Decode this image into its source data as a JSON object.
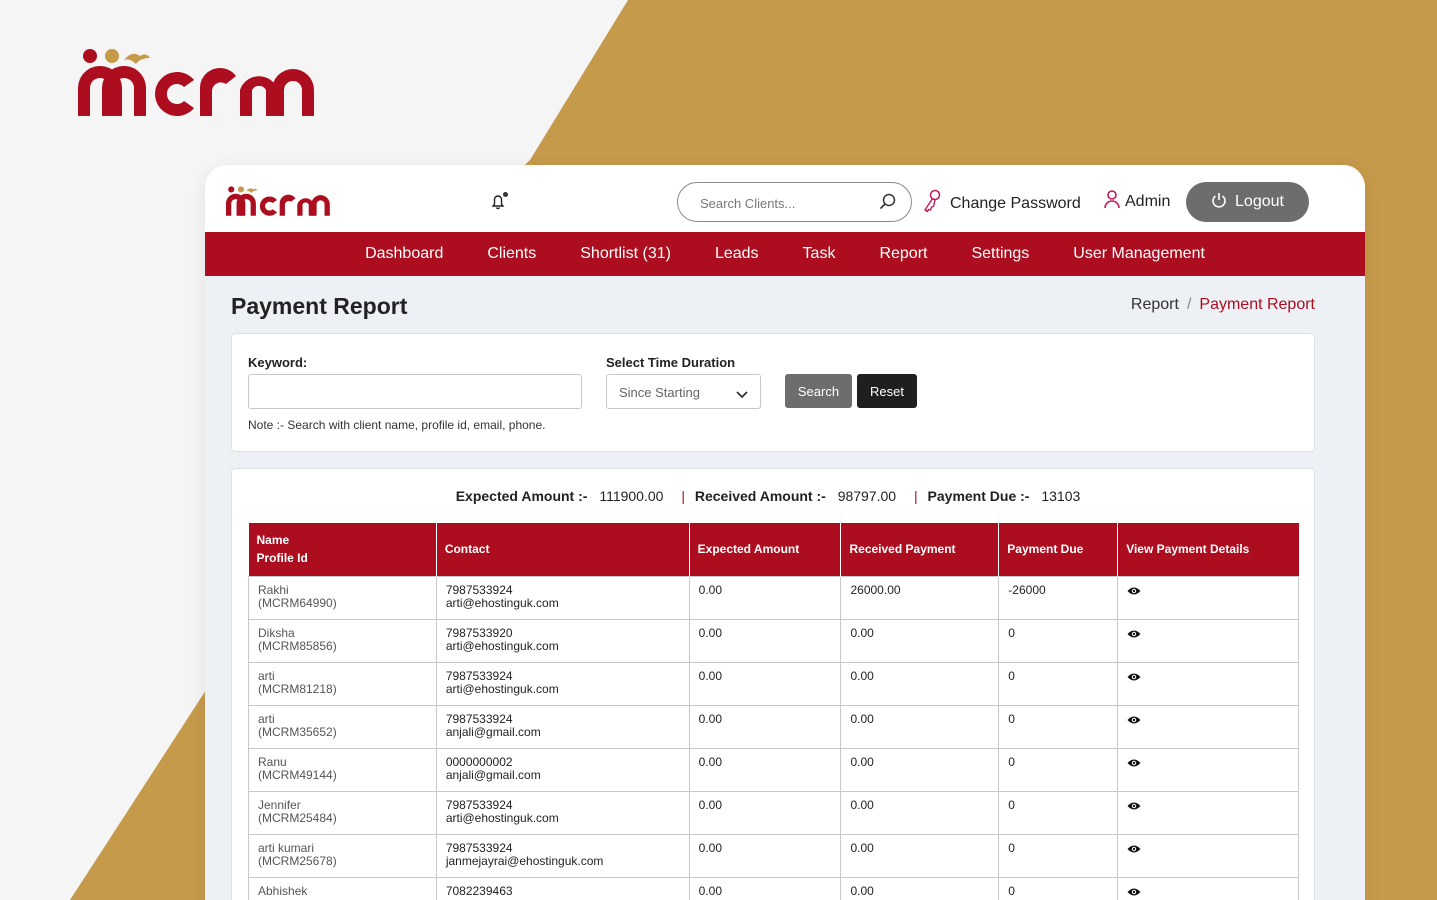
{
  "brand": {
    "name": "mcrm",
    "primary": "#ac0d1f",
    "gold": "#c69a4b"
  },
  "header": {
    "search_placeholder": "Search Clients...",
    "change_password": "Change Password",
    "admin": "Admin",
    "logout": "Logout"
  },
  "nav": [
    "Dashboard",
    "Clients",
    "Shortlist (31)",
    "Leads",
    "Task",
    "Report",
    "Settings",
    "User Management"
  ],
  "page": {
    "title": "Payment Report",
    "breadcrumb": {
      "parent": "Report",
      "separator": "/",
      "current": "Payment Report"
    }
  },
  "filters": {
    "keyword_label": "Keyword:",
    "keyword_value": "",
    "duration_label": "Select Time Duration",
    "duration_value": "Since Starting",
    "search_button": "Search",
    "reset_button": "Reset",
    "note": "Note :- Search with client name, profile id, email, phone."
  },
  "summary": {
    "expected_label": "Expected Amount :-",
    "expected_value": "111900.00",
    "received_label": "Received Amount :-",
    "received_value": "98797.00",
    "due_label": "Payment Due :-",
    "due_value": "13103"
  },
  "table": {
    "headers": {
      "name": "Name",
      "profile": "Profile Id",
      "contact": "Contact",
      "expected": "Expected Amount",
      "received": "Received Payment",
      "due": "Payment Due",
      "view": "View Payment Details"
    },
    "rows": [
      {
        "name": "Rakhi",
        "profile": "(MCRM64990)",
        "phone": "7987533924",
        "email": "arti@ehostinguk.com",
        "expected": "0.00",
        "received": "26000.00",
        "due": "-26000"
      },
      {
        "name": "Diksha",
        "profile": "(MCRM85856)",
        "phone": "7987533920",
        "email": "arti@ehostinguk.com",
        "expected": "0.00",
        "received": "0.00",
        "due": "0"
      },
      {
        "name": "arti",
        "profile": "(MCRM81218)",
        "phone": "7987533924",
        "email": "arti@ehostinguk.com",
        "expected": "0.00",
        "received": "0.00",
        "due": "0"
      },
      {
        "name": "arti",
        "profile": "(MCRM35652)",
        "phone": "7987533924",
        "email": "anjali@gmail.com",
        "expected": "0.00",
        "received": "0.00",
        "due": "0"
      },
      {
        "name": "Ranu",
        "profile": "(MCRM49144)",
        "phone": "0000000002",
        "email": "anjali@gmail.com",
        "expected": "0.00",
        "received": "0.00",
        "due": "0"
      },
      {
        "name": "Jennifer",
        "profile": "(MCRM25484)",
        "phone": "7987533924",
        "email": "arti@ehostinguk.com",
        "expected": "0.00",
        "received": "0.00",
        "due": "0"
      },
      {
        "name": "arti kumari",
        "profile": "(MCRM25678)",
        "phone": "7987533924",
        "email": "janmejayrai@ehostinguk.com",
        "expected": "0.00",
        "received": "0.00",
        "due": "0"
      },
      {
        "name": "Abhishek",
        "profile": "",
        "phone": "7082239463",
        "email": "",
        "expected": "0.00",
        "received": "0.00",
        "due": "0"
      }
    ]
  }
}
